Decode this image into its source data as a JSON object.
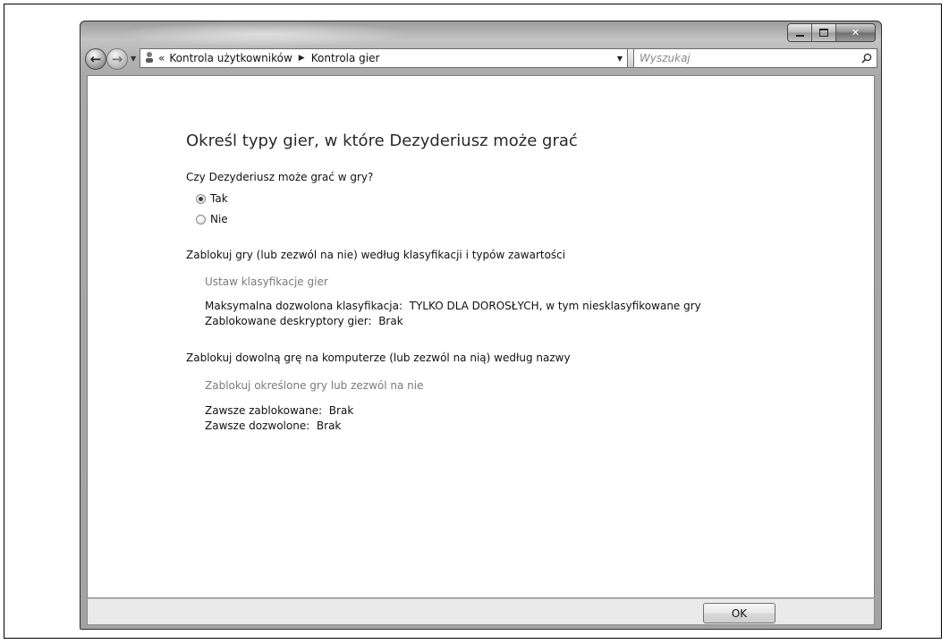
{
  "nav": {
    "breadcrumb_chevrons": "«",
    "breadcrumb": [
      "Kontrola użytkowników",
      "Kontrola gier"
    ],
    "search_placeholder": "Wyszukaj"
  },
  "content": {
    "heading": "Określ typy gier, w które Dezyderiusz może grać",
    "question": "Czy Dezyderiusz może grać w gry?",
    "radio_options": [
      {
        "label": "Tak",
        "checked": true
      },
      {
        "label": "Nie",
        "checked": false
      }
    ],
    "section1": {
      "title": "Zablokuj gry (lub zezwól na nie) według klasyfikacji i typów zawartości",
      "link": "Ustaw klasyfikacje gier",
      "rating_label": "Maksymalna dozwolona klasyfikacja:",
      "rating_value": "TYLKO DLA DOROSŁYCH, w tym niesklasyfikowane gry",
      "descriptors_label": "Zablokowane deskryptory gier:",
      "descriptors_value": "Brak"
    },
    "section2": {
      "title": "Zablokuj dowolną grę na komputerze (lub zezwól na nią) według nazwy",
      "link": "Zablokuj określone gry lub zezwól na nie",
      "always_blocked_label": "Zawsze zablokowane:",
      "always_blocked_value": "Brak",
      "always_allowed_label": "Zawsze dozwolone:",
      "always_allowed_value": "Brak"
    }
  },
  "footer": {
    "ok_label": "OK"
  }
}
